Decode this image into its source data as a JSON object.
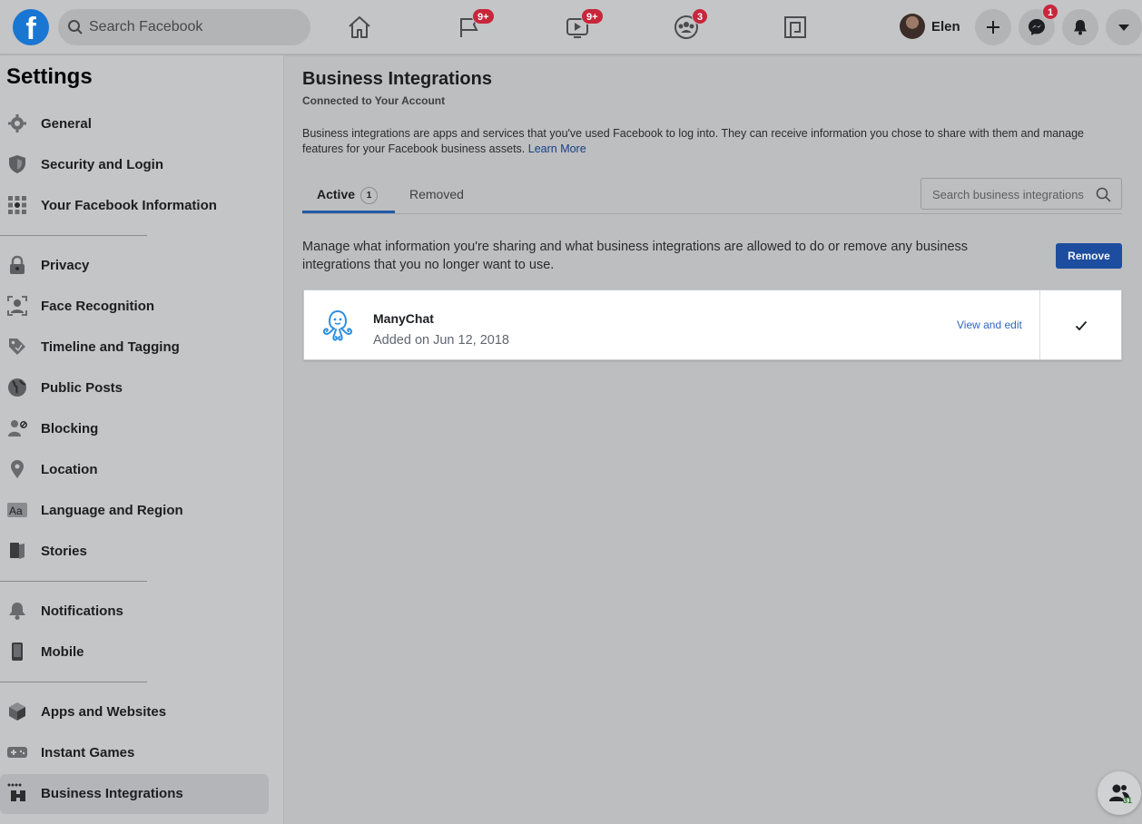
{
  "topbar": {
    "logo": "f",
    "search_placeholder": "Search Facebook",
    "nav": [
      {
        "icon": "home-icon",
        "badge": ""
      },
      {
        "icon": "pages-flag-icon",
        "badge": "9+"
      },
      {
        "icon": "watch-video-icon",
        "badge": "9+"
      },
      {
        "icon": "groups-icon",
        "badge": "3"
      },
      {
        "icon": "gaming-icon",
        "badge": ""
      }
    ],
    "profile_name": "Elen",
    "messenger_badge": "1"
  },
  "sidebar": {
    "title": "Settings",
    "items": [
      {
        "label": "General",
        "icon": "gear-icon"
      },
      {
        "label": "Security and Login",
        "icon": "shield-icon"
      },
      {
        "label": "Your Facebook Information",
        "icon": "grid-icon"
      },
      {
        "label": "Privacy",
        "icon": "lock-icon"
      },
      {
        "label": "Face Recognition",
        "icon": "face-scan-icon"
      },
      {
        "label": "Timeline and Tagging",
        "icon": "tag-icon"
      },
      {
        "label": "Public Posts",
        "icon": "globe-icon"
      },
      {
        "label": "Blocking",
        "icon": "user-block-icon"
      },
      {
        "label": "Location",
        "icon": "location-pin-icon"
      },
      {
        "label": "Language and Region",
        "icon": "language-icon"
      },
      {
        "label": "Stories",
        "icon": "book-icon"
      },
      {
        "label": "Notifications",
        "icon": "bell-icon"
      },
      {
        "label": "Mobile",
        "icon": "phone-icon"
      },
      {
        "label": "Apps and Websites",
        "icon": "cube-icon"
      },
      {
        "label": "Instant Games",
        "icon": "gamepad-icon"
      },
      {
        "label": "Business Integrations",
        "icon": "business-integrations-icon"
      }
    ],
    "active_item": "Business Integrations"
  },
  "main": {
    "title": "Business Integrations",
    "subtitle": "Connected to Your Account",
    "intro": "Business integrations are apps and services that you've used Facebook to log into. They can receive information you chose to share with them and manage features for your Facebook business assets.",
    "learn_more": "Learn More",
    "tabs": [
      {
        "label": "Active",
        "count": "1"
      },
      {
        "label": "Removed"
      }
    ],
    "search_placeholder": "Search business integrations",
    "manage_text": "Manage what information you're sharing and what business integrations are allowed to do or remove any business integrations that you no longer want to use.",
    "remove_label": "Remove",
    "integrations": [
      {
        "name": "ManyChat",
        "added": "Added on Jun 12, 2018",
        "link": "View and edit",
        "checked": true
      }
    ]
  },
  "friends_fab": {
    "count": "31"
  },
  "colors": {
    "accent": "#1c4d9e",
    "badge": "#c7263b",
    "link": "#2f66c0"
  }
}
